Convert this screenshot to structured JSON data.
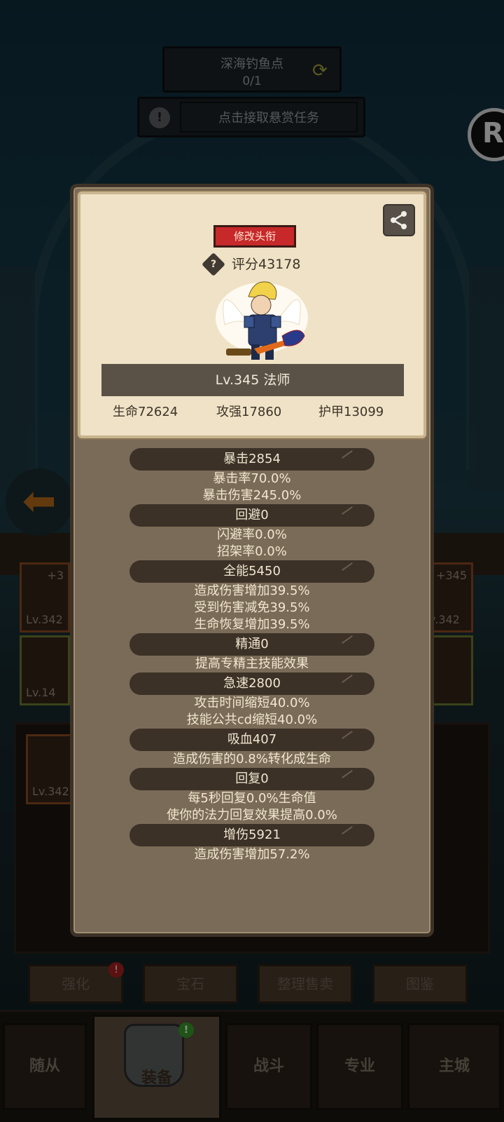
{
  "background": {
    "quest": {
      "title": "深海钓鱼点",
      "count": "0/1"
    },
    "bounty_label": "点击接取悬赏任务",
    "slots": [
      {
        "plus": "+3",
        "level": "Lv.342"
      },
      {
        "plus": "+345",
        "level": "v.342"
      },
      {
        "level": "Lv.14"
      },
      {
        "level": "Lv.342"
      }
    ],
    "actions": [
      "强化",
      "宝石",
      "整理售卖",
      "图鉴"
    ],
    "nav": [
      "随从",
      "装备",
      "战斗",
      "专业",
      "主城"
    ]
  },
  "profile": {
    "title_button": "修改头衔",
    "score": "评分43178",
    "level_class": "Lv.345 法师",
    "stats": [
      "生命72624",
      "攻强17860",
      "护甲13099"
    ]
  },
  "attributes": [
    {
      "header": "暴击2854",
      "lines": [
        "暴击率70.0%",
        "暴击伤害245.0%"
      ]
    },
    {
      "header": "回避0",
      "lines": [
        "闪避率0.0%",
        "招架率0.0%"
      ]
    },
    {
      "header": "全能5450",
      "lines": [
        "造成伤害增加39.5%",
        "受到伤害减免39.5%",
        "生命恢复增加39.5%"
      ]
    },
    {
      "header": "精通0",
      "lines": [
        "提高专精主技能效果"
      ]
    },
    {
      "header": "急速2800",
      "lines": [
        "攻击时间缩短40.0%",
        "技能公共cd缩短40.0%"
      ]
    },
    {
      "header": "吸血407",
      "lines": [
        "造成伤害的0.8%转化成生命"
      ]
    },
    {
      "header": "回复0",
      "lines": [
        "每5秒回复0.0%生命值",
        "使你的法力回复效果提高0.0%"
      ]
    },
    {
      "header": "增伤5921",
      "lines": [
        "造成伤害增加57.2%"
      ]
    }
  ]
}
